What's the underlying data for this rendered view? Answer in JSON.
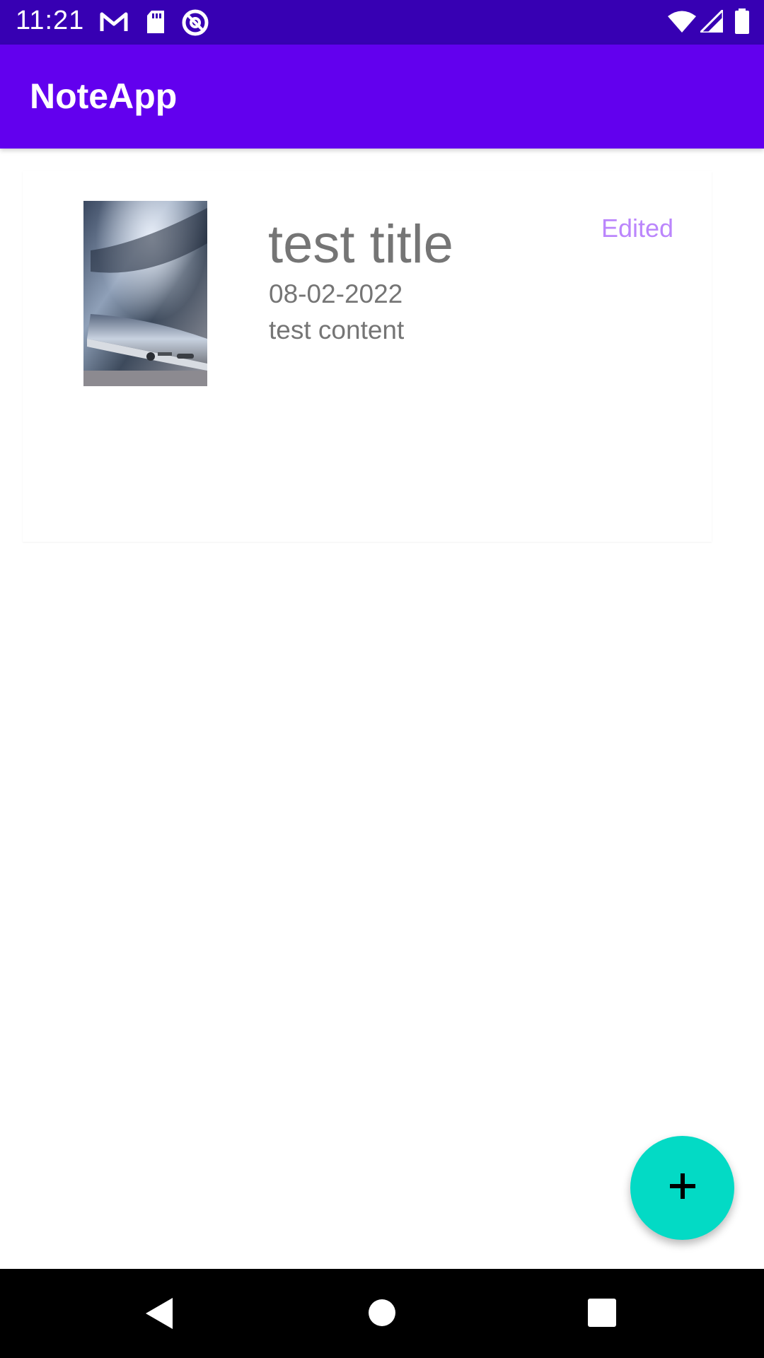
{
  "status_bar": {
    "time": "11:21",
    "icons": [
      "gmail-icon",
      "sd-card-icon",
      "at-sign-icon",
      "wifi-icon",
      "signal-icon",
      "battery-icon"
    ],
    "background": "#3700b3"
  },
  "app_bar": {
    "title": "NoteApp",
    "background": "#6200ee"
  },
  "notes": [
    {
      "title": "test title",
      "date": "08-02-2022",
      "content": "test content",
      "status": "Edited",
      "thumbnail": "smartphone-photo"
    }
  ],
  "fab": {
    "icon": "plus-icon",
    "color": "#03dac5"
  },
  "nav_bar": {
    "icons": [
      "back-icon",
      "home-icon",
      "recents-icon"
    ]
  }
}
